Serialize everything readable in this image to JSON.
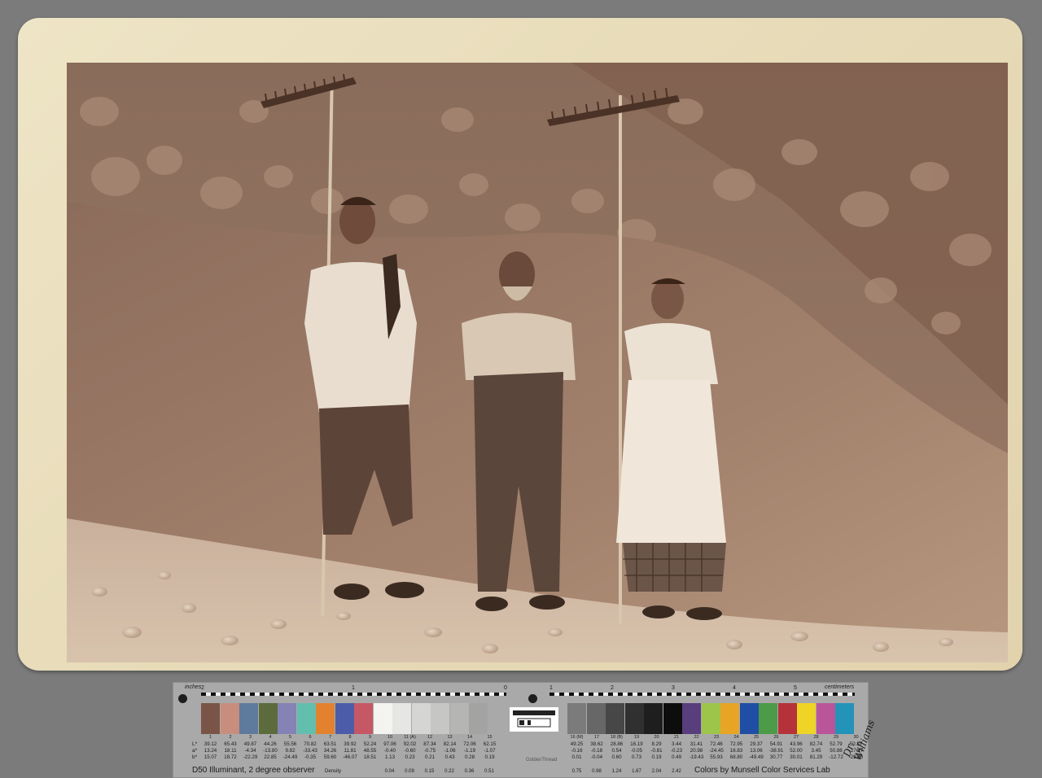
{
  "image": {
    "subject": "sepia photograph of three workers with rakes in front of a gravel slope",
    "colors": {
      "background": "#7b7b7b",
      "card": "#e8dcba",
      "print_tone": "#8f7260"
    }
  },
  "target": {
    "label_inches": "inches",
    "label_centimeters": "centimeters",
    "ruler_inches": [
      "2",
      "1",
      "0",
      "1",
      "2",
      "3",
      "4",
      "5"
    ],
    "illuminant": "D50 Illuminant, 2 degree observer",
    "density_label": "Density",
    "credit": "Colors by Munsell Color Services Lab",
    "signature": "Dr. Williams",
    "logo_text": "GoldenThread",
    "axis_letters": "L*\na*\nb*",
    "patches_left": [
      {
        "n": "1",
        "color": "#7a5547",
        "vals": "39.12\n13.24\n15.07"
      },
      {
        "n": "2",
        "color": "#c88d7c",
        "vals": "65.43\n18.11\n18.72"
      },
      {
        "n": "3",
        "color": "#5f7a9d",
        "vals": "49.87\n-4.34\n-22.29"
      },
      {
        "n": "4",
        "color": "#5c6b3c",
        "vals": "44.26\n-13.80\n22.85"
      },
      {
        "n": "5",
        "color": "#8582b6",
        "vals": "55.56\n9.82\n-24.49"
      },
      {
        "n": "6",
        "color": "#62bfae",
        "vals": "70.82\n-33.43\n-0.35"
      },
      {
        "n": "7",
        "color": "#e2822f",
        "vals": "63.51\n34.26\n59.60"
      },
      {
        "n": "8",
        "color": "#4c5ca9",
        "vals": "39.92\n11.81\n-46.07"
      },
      {
        "n": "9",
        "color": "#c65765",
        "vals": "52.24\n48.55\n18.51"
      },
      {
        "n": "10",
        "color": "#f3f3f0",
        "vals": "97.06\n-0.40\n1.13"
      },
      {
        "n": "11 (A)",
        "color": "#e6e6e4",
        "vals": "92.02\n-0.60\n0.23"
      },
      {
        "n": "12",
        "color": "#d5d5d3",
        "vals": "87.34\n-0.75\n0.21"
      },
      {
        "n": "13",
        "color": "#c6c6c5",
        "vals": "82.14\n-1.06\n0.43"
      },
      {
        "n": "14",
        "color": "#b5b5b4",
        "vals": "72.06\n-1.19\n0.28"
      },
      {
        "n": "15",
        "color": "#a3a3a2",
        "vals": "62.15\n-1.07\n0.19"
      }
    ],
    "density_left": [
      "0.04",
      "0.09",
      "0.15",
      "0.22",
      "0.36",
      "0.51"
    ],
    "patches_right": [
      {
        "n": "16 (M)",
        "color": "#7b7b7b",
        "vals": "49.25\n-0.16\n0.01"
      },
      {
        "n": "17",
        "color": "#676767",
        "vals": "38.62\n-0.18\n-0.04"
      },
      {
        "n": "18 (B)",
        "color": "#474747",
        "vals": "28.86\n0.54\n0.60"
      },
      {
        "n": "19",
        "color": "#303030",
        "vals": "16.19\n-0.05\n0.73"
      },
      {
        "n": "20",
        "color": "#1e1e1e",
        "vals": "8.29\n-0.81\n0.19"
      },
      {
        "n": "21",
        "color": "#0d0d0d",
        "vals": "3.44\n-0.23\n0.49"
      },
      {
        "n": "22",
        "color": "#583e7d",
        "vals": "31.41\n20.98\n-19.43"
      },
      {
        "n": "23",
        "color": "#9cc54a",
        "vals": "72.46\n-24.45\n55.93"
      },
      {
        "n": "24",
        "color": "#e8a425",
        "vals": "72.95\n16.83\n68.80"
      },
      {
        "n": "25",
        "color": "#1f4ea4",
        "vals": "29.37\n13.06\n-49.49"
      },
      {
        "n": "26",
        "color": "#4d9a48",
        "vals": "54.91\n-38.91\n30.77"
      },
      {
        "n": "27",
        "color": "#b5323a",
        "vals": "43.96\n52.00\n30.01"
      },
      {
        "n": "28",
        "color": "#efd325",
        "vals": "82.74\n3.45\n81.29"
      },
      {
        "n": "29",
        "color": "#bb559a",
        "vals": "52.79\n50.88\n-12.72"
      },
      {
        "n": "30",
        "color": "#2393b8",
        "vals": "50.87\n-27.17\n-29.46"
      }
    ],
    "density_right": [
      "0.75",
      "0.98",
      "1.24",
      "1.67",
      "2.04",
      "2.42"
    ]
  }
}
